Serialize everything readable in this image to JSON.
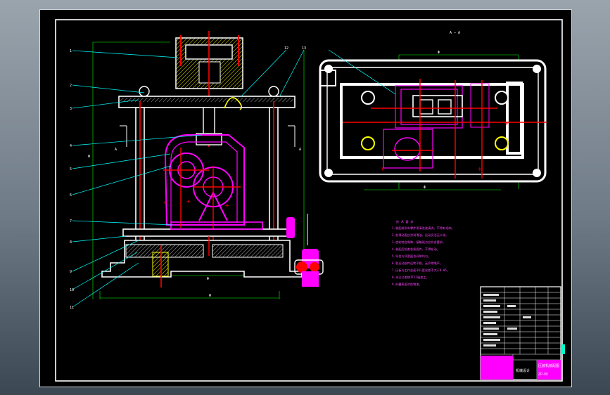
{
  "drawing": {
    "section_label": "A — A",
    "section_marks": [
      "A",
      "A"
    ],
    "part_numbers": [
      "1",
      "2",
      "3",
      "4",
      "5",
      "6",
      "7",
      "8",
      "9",
      "10",
      "11",
      "12",
      "13"
    ],
    "dimension_labels": [
      "Φ",
      "Φ",
      "Φ",
      "Φ",
      "Φ"
    ],
    "tech_requirements": {
      "title": "技 术 要 求",
      "lines": [
        "1.装配前所有零件用清洗液清洗，不得有毛刺。",
        "2.各滑动面应涂润滑油，运动灵活无卡滞。",
        "3.齿轮啮合侧隙，接触斑点应符合要求。",
        "4.装配后检查各紧固件，不得松动。",
        "5.导柱与导套配合间隙均匀。",
        "6.各运动部件运转平稳，无异常噪声。",
        "7.压板与工作台面平行度误差不大于0.05。",
        "8.未注公差按IT12级加工。",
        "9.外露表面涂防锈漆。"
      ]
    },
    "title_block": {
      "title_text": "压装机装配图",
      "school_text": "机械设计",
      "drawing_no": "ZP-00"
    }
  },
  "colors": {
    "frame": "#ffffff",
    "part": "#ff00ff",
    "centerline": "#ff0000",
    "hatch": "#ffff00",
    "leader": "#00ffff",
    "dimension": "#00ff00"
  }
}
